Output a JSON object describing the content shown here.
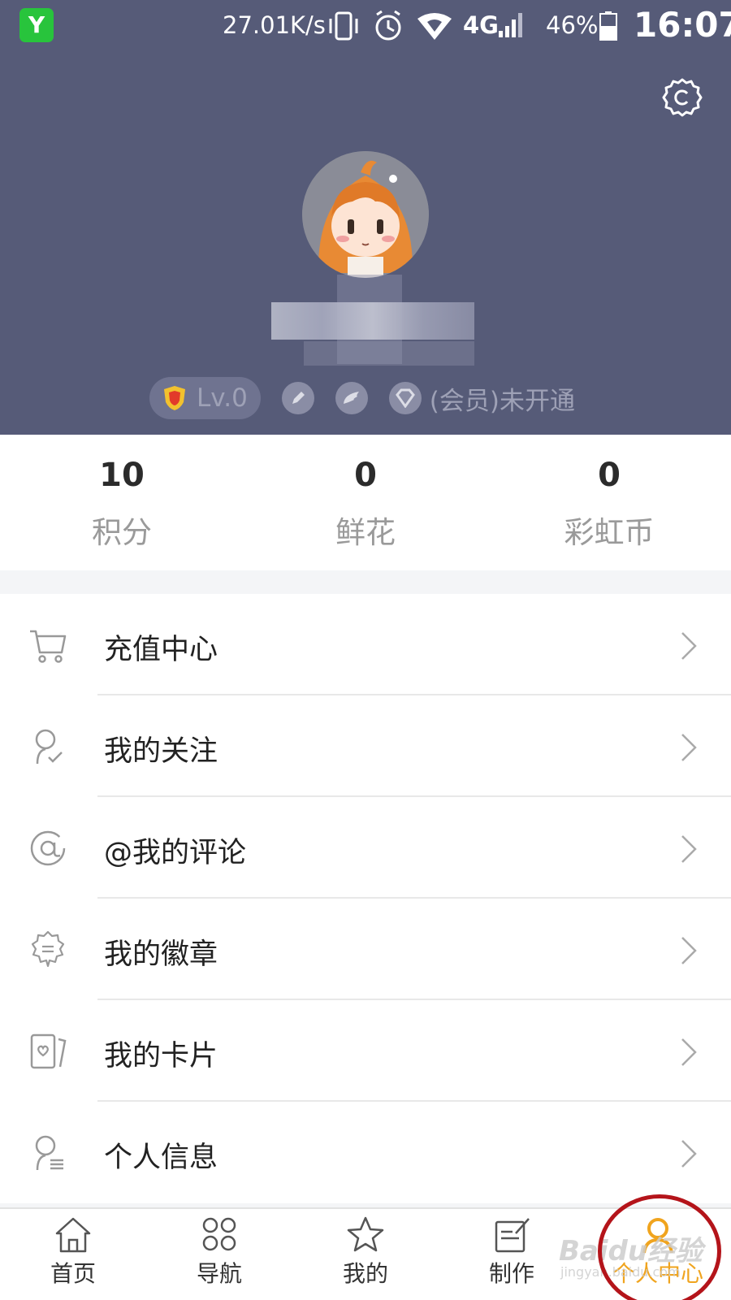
{
  "status_bar": {
    "app_icon_letter": "Y",
    "network_speed": "27.01K/s",
    "network_type": "4G",
    "battery_percent": "46%",
    "time": "16:07"
  },
  "profile": {
    "level": "Lv.0",
    "membership": "(会员)未开通"
  },
  "stats": [
    {
      "value": "10",
      "label": "积分"
    },
    {
      "value": "0",
      "label": "鲜花"
    },
    {
      "value": "0",
      "label": "彩虹币"
    }
  ],
  "menu": [
    {
      "label": "充值中心",
      "icon": "cart-icon"
    },
    {
      "label": "我的关注",
      "icon": "follow-icon"
    },
    {
      "label": "@我的评论",
      "icon": "at-icon"
    },
    {
      "label": "我的徽章",
      "icon": "badge-icon"
    },
    {
      "label": "我的卡片",
      "icon": "card-icon"
    },
    {
      "label": "个人信息",
      "icon": "profile-info-icon"
    }
  ],
  "bottom_nav": [
    {
      "label": "首页",
      "icon": "home-icon",
      "active": false
    },
    {
      "label": "导航",
      "icon": "grid-icon",
      "active": false
    },
    {
      "label": "我的",
      "icon": "star-icon",
      "active": false
    },
    {
      "label": "制作",
      "icon": "edit-icon",
      "active": false
    },
    {
      "label": "个人中心",
      "icon": "user-icon",
      "active": true
    }
  ],
  "watermark": {
    "text": "Baidu经验",
    "sub": "jingyan.baidu.com"
  },
  "colors": {
    "header_bg": "#565b78",
    "accent": "#f0a41e",
    "annotation_red": "#b4141a"
  }
}
